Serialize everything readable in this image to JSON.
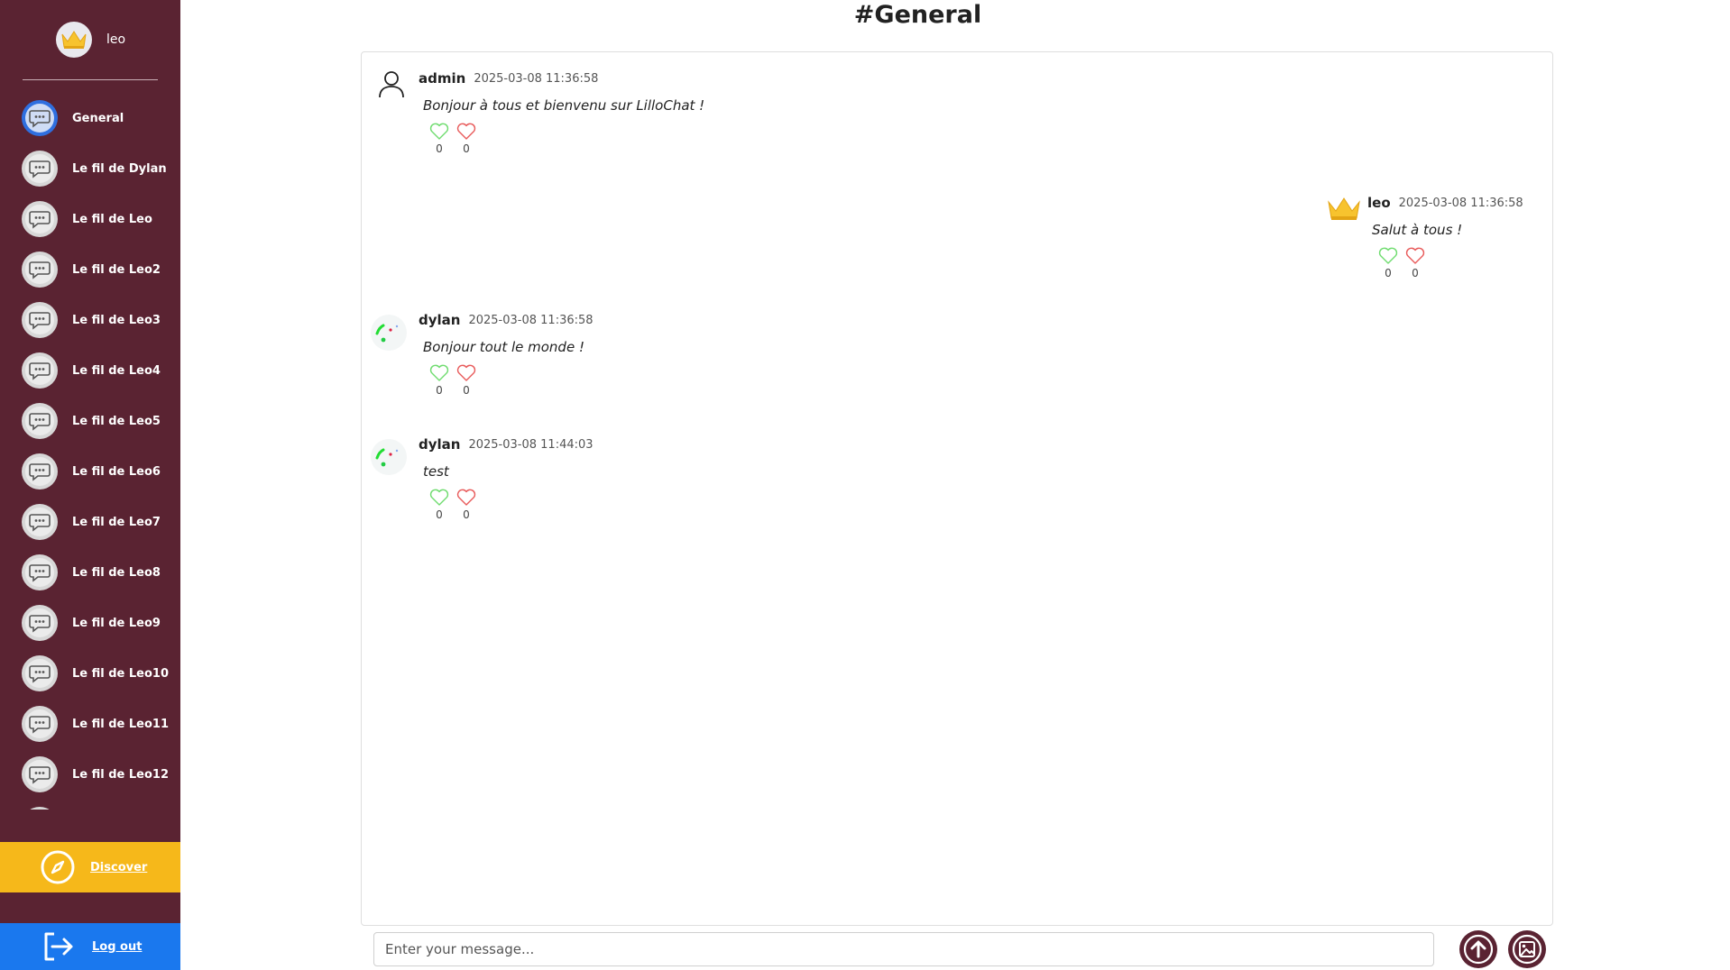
{
  "user": {
    "name": "leo"
  },
  "channel_title": "#General",
  "channels": [
    {
      "label": "General",
      "active": true
    },
    {
      "label": "Le fil de Dylan"
    },
    {
      "label": "Le fil de Leo"
    },
    {
      "label": "Le fil de Leo2"
    },
    {
      "label": "Le fil de Leo3"
    },
    {
      "label": "Le fil de Leo4"
    },
    {
      "label": "Le fil de Leo5"
    },
    {
      "label": "Le fil de Leo6"
    },
    {
      "label": "Le fil de Leo7"
    },
    {
      "label": "Le fil de Leo8"
    },
    {
      "label": "Le fil de Leo9"
    },
    {
      "label": "Le fil de Leo10"
    },
    {
      "label": "Le fil de Leo11"
    },
    {
      "label": "Le fil de Leo12"
    },
    {
      "label": ""
    }
  ],
  "discover_label": "Discover",
  "logout_label": "Log out",
  "messages": [
    {
      "author": "admin",
      "time": "2025-03-08 11:36:58",
      "text": "Bonjour à tous et bienvenu sur LilloChat !",
      "likes": "0",
      "dislikes": "0",
      "avatar": "user-outline-icon"
    },
    {
      "author": "leo",
      "time": "2025-03-08 11:36:58",
      "text": "Salut à tous !",
      "likes": "0",
      "dislikes": "0",
      "avatar": "crown-icon"
    },
    {
      "author": "dylan",
      "time": "2025-03-08 11:36:58",
      "text": "Bonjour tout le monde !",
      "likes": "0",
      "dislikes": "0",
      "avatar": "abstract-avatar-icon"
    },
    {
      "author": "dylan",
      "time": "2025-03-08 11:44:03",
      "text": "test",
      "likes": "0",
      "dislikes": "0",
      "avatar": "abstract-avatar-icon"
    }
  ],
  "composer": {
    "placeholder": "Enter your message..."
  },
  "colors": {
    "sidebar": "#5a2332",
    "discover": "#f6b81a",
    "logout": "#1a78ee",
    "active_channel": "#2f6fe0",
    "like": "#6fdc6f",
    "dislike": "#e85a5a"
  }
}
